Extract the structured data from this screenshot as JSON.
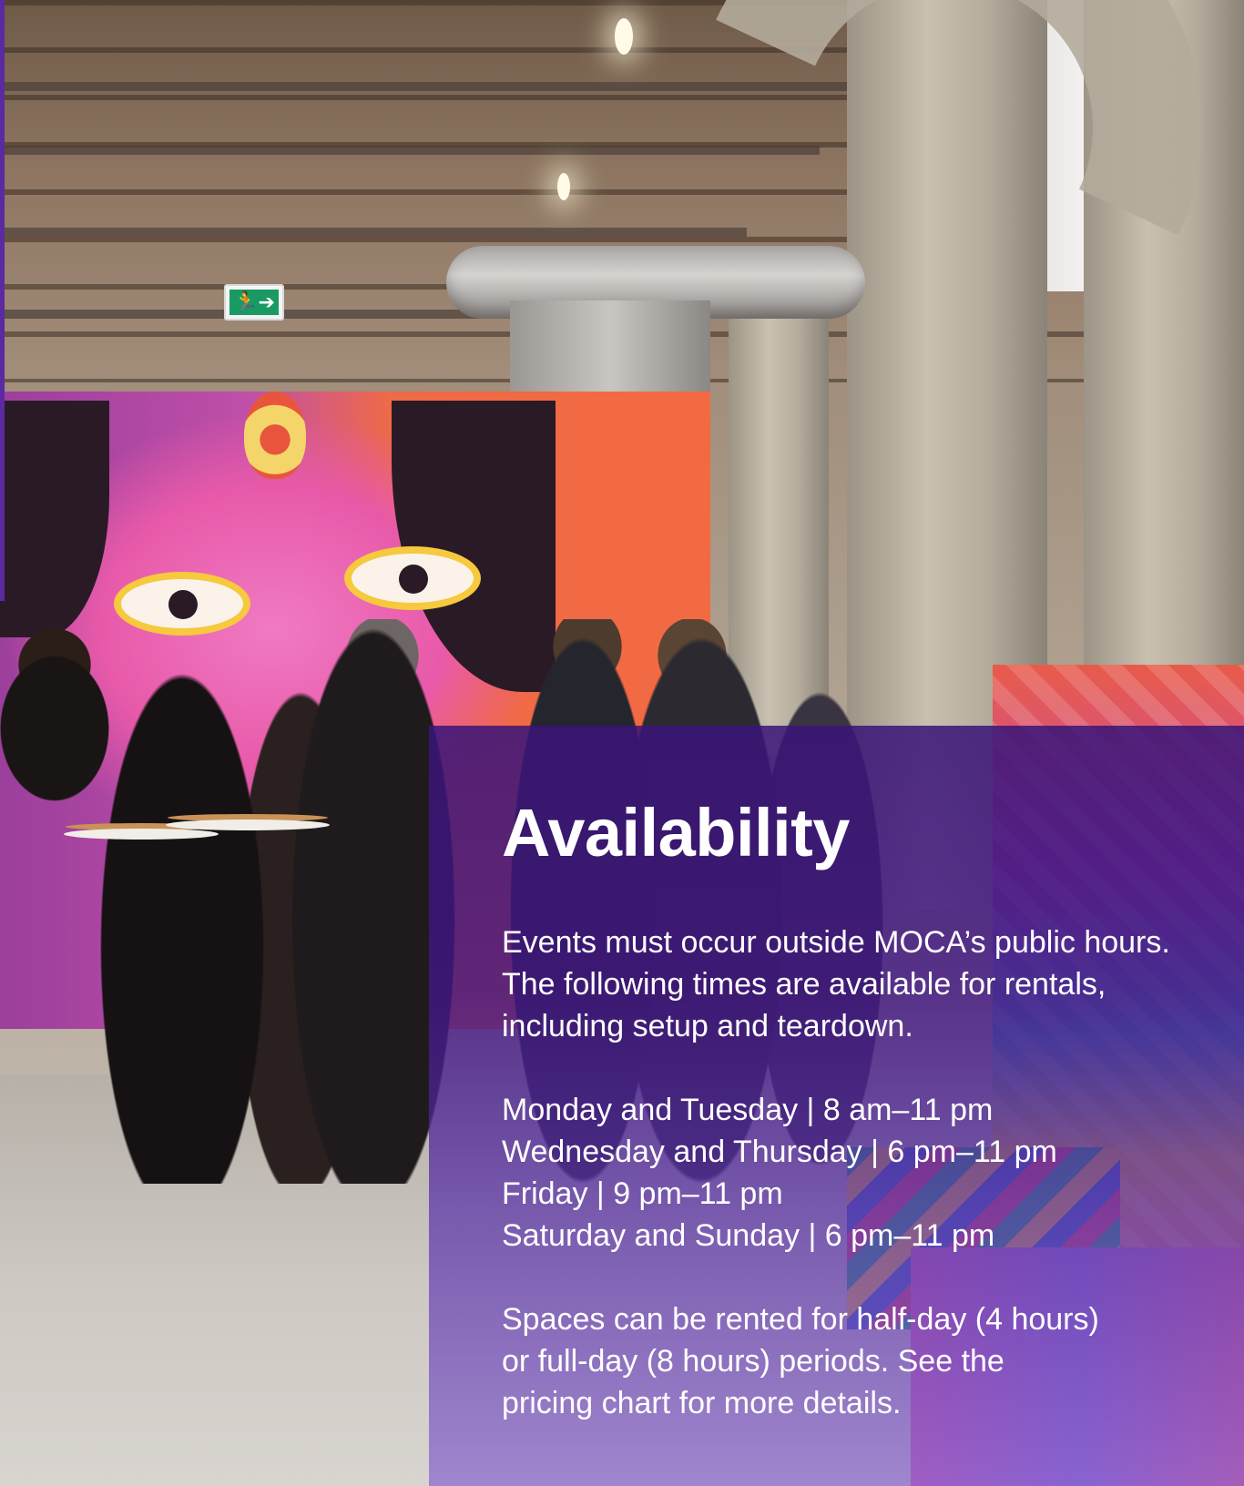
{
  "availability": {
    "heading": "Availability",
    "intro": "Events must occur outside MOCA’s public hours. The following times are available for rentals, including setup and teardown.",
    "schedule": [
      "Monday and Tuesday | 8 am–11 pm",
      "Wednesday and Thursday | 6 pm–11 pm",
      "Friday | 9 pm–11 pm",
      "Saturday and Sunday | 6 pm–11 pm"
    ],
    "note": "Spaces can be rented for half-day (4 hours) or full-day (8 hours) periods. See the pricing chart for more details."
  },
  "background": {
    "exit_sign_glyph": "🏃➔",
    "panel_color": "#3a1478"
  }
}
